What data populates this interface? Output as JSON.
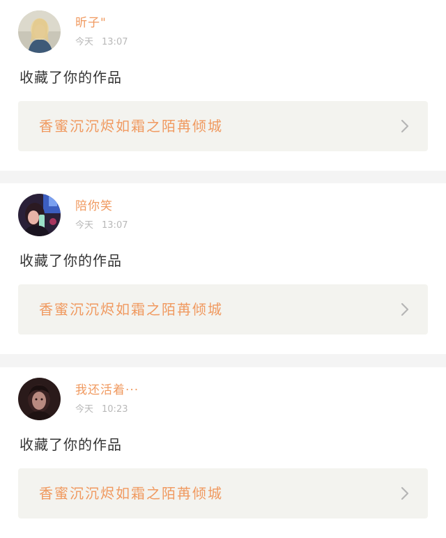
{
  "theme": {
    "accent": "#f0995f",
    "chevron": "#b5b5b5"
  },
  "notifications": [
    {
      "user_name": "昕子\"",
      "date_label": "今天",
      "time": "13:07",
      "action_text": "收藏了你的作品",
      "work_title": "香蜜沉沉烬如霜之陌苒倾城",
      "avatar_icon": "user-avatar-icon"
    },
    {
      "user_name": "陪你笑",
      "date_label": "今天",
      "time": "13:07",
      "action_text": "收藏了你的作品",
      "work_title": "香蜜沉沉烬如霜之陌苒倾城",
      "avatar_icon": "user-avatar-icon"
    },
    {
      "user_name": "我还活着···",
      "date_label": "今天",
      "time": "10:23",
      "action_text": "收藏了你的作品",
      "work_title": "香蜜沉沉烬如霜之陌苒倾城",
      "avatar_icon": "user-avatar-icon"
    }
  ]
}
